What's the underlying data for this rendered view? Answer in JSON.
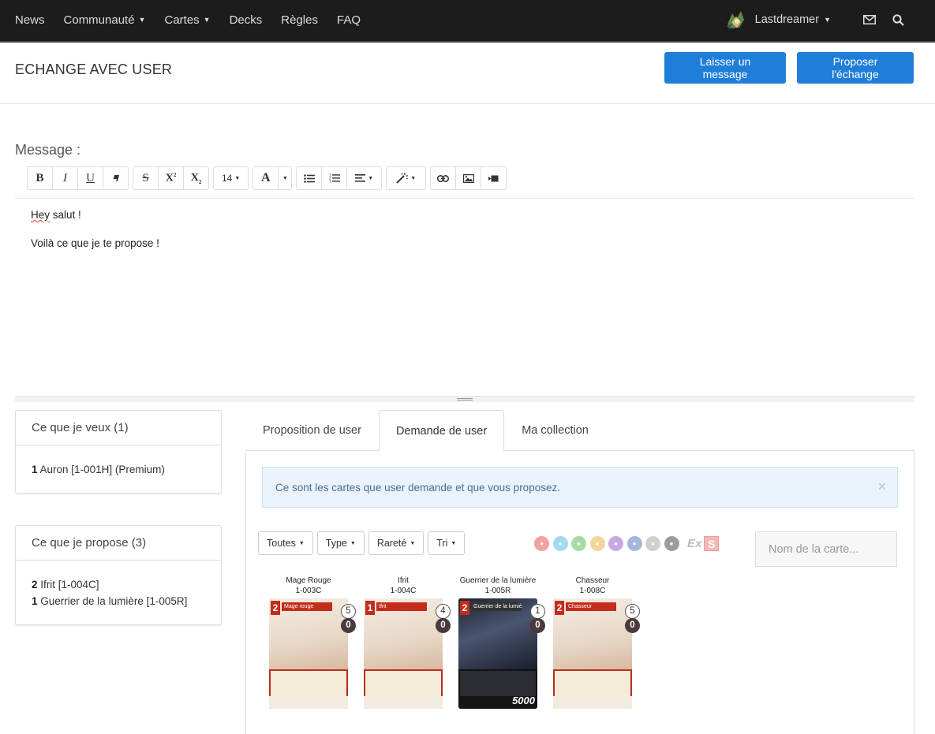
{
  "nav": {
    "items": [
      {
        "label": "News",
        "dropdown": false
      },
      {
        "label": "Communauté",
        "dropdown": true
      },
      {
        "label": "Cartes",
        "dropdown": true
      },
      {
        "label": "Decks",
        "dropdown": false
      },
      {
        "label": "Règles",
        "dropdown": false
      },
      {
        "label": "FAQ",
        "dropdown": false
      }
    ],
    "user": "Lastdreamer",
    "icons": [
      "mail-icon",
      "search-icon"
    ]
  },
  "header": {
    "title": "ECHANGE AVEC USER",
    "leave_message": "Laisser un message",
    "propose_exchange": "Proposer l'échange"
  },
  "editor": {
    "label": "Message :",
    "font_size": "14",
    "lines": [
      "Hey salut !",
      "Voilà ce que je te propose !"
    ]
  },
  "want_panel": {
    "title": "Ce que je veux (1)",
    "items": [
      {
        "qty": "1",
        "text": "Auron [1-001H] (Premium)"
      }
    ]
  },
  "propose_panel": {
    "title": "Ce que je propose (3)",
    "items": [
      {
        "qty": "2",
        "text": "Ifrit [1-004C]"
      },
      {
        "qty": "1",
        "text": "Guerrier de la lumière [1-005R]"
      }
    ]
  },
  "tabs": [
    {
      "label": "Proposition de user",
      "active": false
    },
    {
      "label": "Demande de user",
      "active": true
    },
    {
      "label": "Ma collection",
      "active": false
    }
  ],
  "alert": {
    "text": "Ce sont les cartes que user demande et que vous proposez.",
    "close": "×"
  },
  "filters": [
    "Toutes",
    "Type",
    "Rareté",
    "Tri"
  ],
  "elements": [
    {
      "name": "fire-element-icon",
      "color": "#f2a1a1"
    },
    {
      "name": "ice-element-icon",
      "color": "#9fdcef"
    },
    {
      "name": "wind-element-icon",
      "color": "#a6dba6"
    },
    {
      "name": "earth-element-icon",
      "color": "#f3d59a"
    },
    {
      "name": "lightning-element-icon",
      "color": "#c9a8e0"
    },
    {
      "name": "water-element-icon",
      "color": "#a6b5dc"
    },
    {
      "name": "light-element-icon",
      "color": "#d0d0d0"
    },
    {
      "name": "dark-element-icon",
      "color": "#9c9c9c"
    }
  ],
  "elements_extra": {
    "ex": "Ex",
    "special": "S"
  },
  "search": {
    "placeholder": "Nom de la carte..."
  },
  "cards": [
    {
      "name": "Mage Rouge",
      "code": "1-003C",
      "cost": "2",
      "card_title": "Mage rouge",
      "available": "5",
      "trade": "0",
      "dark": false,
      "power": ""
    },
    {
      "name": "Ifrit",
      "code": "1-004C",
      "cost": "1",
      "card_title": "Ifrit",
      "available": "4",
      "trade": "0",
      "dark": false,
      "power": ""
    },
    {
      "name": "Guerrier de la lumière",
      "code": "1-005R",
      "cost": "2",
      "card_title": "Guerrier de la lumière",
      "available": "1",
      "trade": "0",
      "dark": true,
      "power": "5000"
    },
    {
      "name": "Chasseur",
      "code": "1-008C",
      "cost": "2",
      "card_title": "Chasseur",
      "available": "5",
      "trade": "0",
      "dark": false,
      "power": ""
    }
  ]
}
